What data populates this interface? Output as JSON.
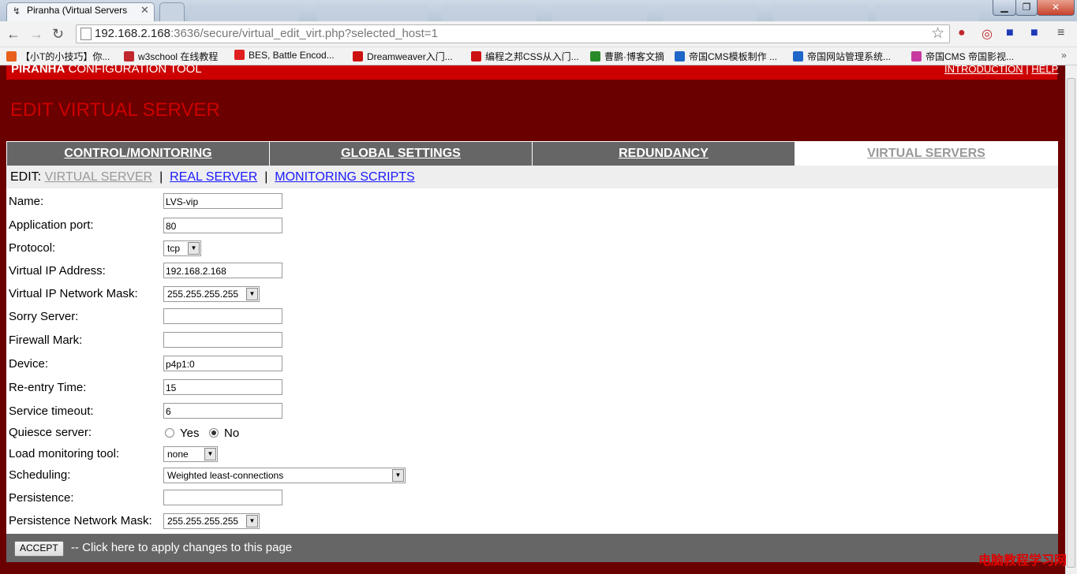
{
  "browser": {
    "tab_title": "Piranha (Virtual Servers",
    "url_host": "192.168.2.168",
    "url_rest": ":3636/secure/virtual_edit_virt.php?selected_host=1",
    "bookmarks": [
      "【小T的小技巧】你...",
      "w3school 在线教程",
      "BES, Battle Encod...",
      "Dreamweaver入门...",
      "编程之邦CSS从入门...",
      "曹鹏·博客文摘",
      "帝国CMS模板制作 ...",
      "帝国网站管理系统...",
      "帝国CMS 帝国影视..."
    ],
    "bookmark_colors": [
      "#e8601c",
      "#c0282d",
      "#e02020",
      "#cc1111",
      "#cc1111",
      "#2a8a2a",
      "#1e66c8",
      "#1e66c8",
      "#c83aa0"
    ]
  },
  "header": {
    "brand_bold": "PIRANHA",
    "brand_rest": " CONFIGURATION TOOL",
    "link_intro": "INTRODUCTION",
    "link_sep": " | ",
    "link_help": "HELP"
  },
  "page_title": "EDIT VIRTUAL SERVER",
  "nav_tabs": [
    "CONTROL/MONITORING",
    "GLOBAL SETTINGS",
    "REDUNDANCY",
    "VIRTUAL SERVERS"
  ],
  "subnav": {
    "prefix": "EDIT: ",
    "items": [
      "VIRTUAL SERVER",
      "REAL SERVER",
      "MONITORING SCRIPTS"
    ],
    "sep": "|"
  },
  "form": {
    "name_label": "Name:",
    "name_value": "LVS-vip",
    "port_label": "Application port:",
    "port_value": "80",
    "protocol_label": "Protocol:",
    "protocol_value": "tcp",
    "vip_label": "Virtual IP Address:",
    "vip_value": "192.168.2.168",
    "vmask_label": "Virtual IP Network Mask:",
    "vmask_value": "255.255.255.255",
    "sorry_label": "Sorry Server:",
    "sorry_value": "",
    "fwmark_label": "Firewall Mark:",
    "fwmark_value": "",
    "device_label": "Device:",
    "device_value": "p4p1:0",
    "reentry_label": "Re-entry Time:",
    "reentry_value": "15",
    "timeout_label": "Service timeout:",
    "timeout_value": "6",
    "quiesce_label": "Quiesce server:",
    "quiesce_yes": "Yes",
    "quiesce_no": "No",
    "load_label": "Load monitoring tool:",
    "load_value": "none",
    "sched_label": "Scheduling:",
    "sched_value": "Weighted least-connections",
    "persist_label": "Persistence:",
    "persist_value": "",
    "pmask_label": "Persistence Network Mask:",
    "pmask_value": "255.255.255.255"
  },
  "accept": {
    "button": "ACCEPT",
    "text": "-- Click here to apply changes to this page"
  },
  "watermark": "电脑教程学习网"
}
